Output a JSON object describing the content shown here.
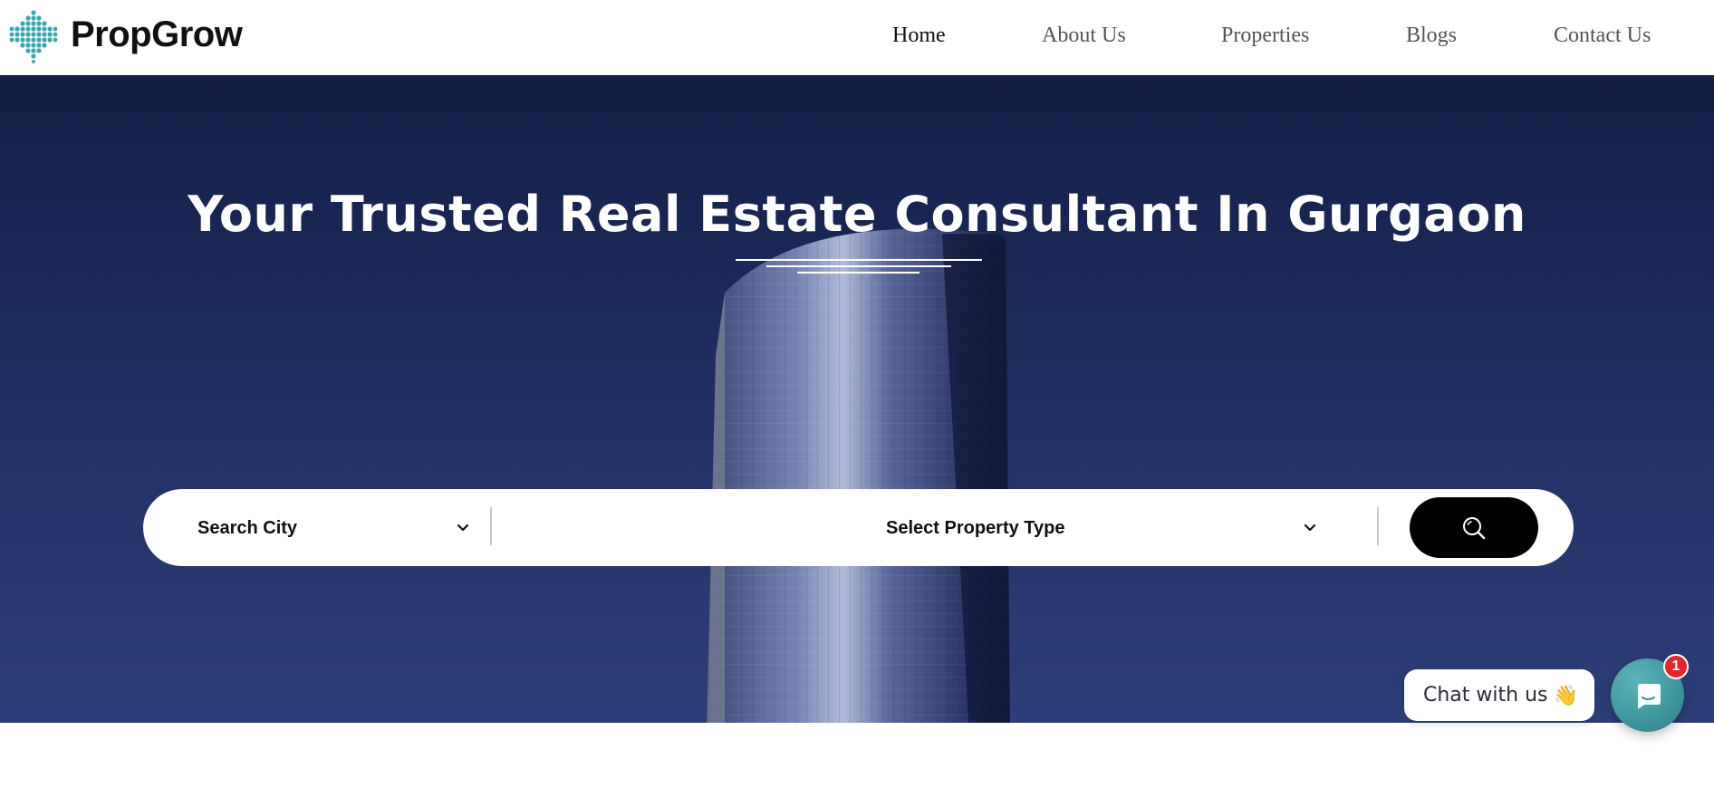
{
  "brand": {
    "name": "PropGrow",
    "accent": "#3aa7b0"
  },
  "nav": {
    "items": [
      {
        "label": "Home",
        "active": true
      },
      {
        "label": "About Us",
        "active": false
      },
      {
        "label": "Properties",
        "active": false
      },
      {
        "label": "Blogs",
        "active": false
      },
      {
        "label": "Contact Us",
        "active": false
      }
    ]
  },
  "hero": {
    "title": "Your Trusted Real Estate Consultant In Gurgaon",
    "image": "glass-tower"
  },
  "search": {
    "city_label": "Search City",
    "property_type_label": "Select Property Type",
    "button_icon": "search-icon"
  },
  "chat": {
    "label": "Chat with us",
    "emoji": "👋",
    "badge_count": "1",
    "icon": "chat-bubble-icon"
  }
}
